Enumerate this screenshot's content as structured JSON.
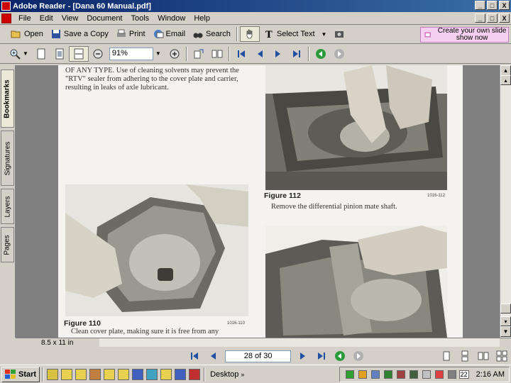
{
  "window": {
    "title": "Adobe Reader - [Dana 60 Manual.pdf]",
    "controls": [
      "_",
      "□",
      "X"
    ]
  },
  "menu": {
    "items": [
      "File",
      "Edit",
      "View",
      "Document",
      "Tools",
      "Window",
      "Help"
    ]
  },
  "toolbar": {
    "open": "Open",
    "save_copy": "Save a Copy",
    "print": "Print",
    "email": "Email",
    "search": "Search",
    "select_text": "Select Text",
    "zoom_value": "91%"
  },
  "promo": {
    "label": "Create your own slide show now"
  },
  "nav_tabs": [
    "Bookmarks",
    "Signatures",
    "Layers",
    "Pages"
  ],
  "page": {
    "top_text": "OF ANY TYPE. Use of cleaning solvents may prevent the \"RTV\" sealer from adhering to the cover plate and carrier, resulting in leaks of axle lubricant.",
    "fig112_title": "Figure 112",
    "fig112_id": "1016-112",
    "fig112_caption": "Remove the differential pinion mate shaft.",
    "fig110_title": "Figure 110",
    "fig110_id": "1016-110",
    "fig110_caption": "Clean cover plate, making sure it is free from any"
  },
  "status": {
    "page_size": "8.5 x 11 in",
    "page_indicator": "28 of 30"
  },
  "taskbar": {
    "start": "Start",
    "desktop": "Desktop",
    "clock": "2:16 AM",
    "tray_number": "22"
  },
  "colors": {
    "titlebar": "#0a246a",
    "promo_bg": "#f5d0f0",
    "page_bg": "#f4f3ef"
  }
}
